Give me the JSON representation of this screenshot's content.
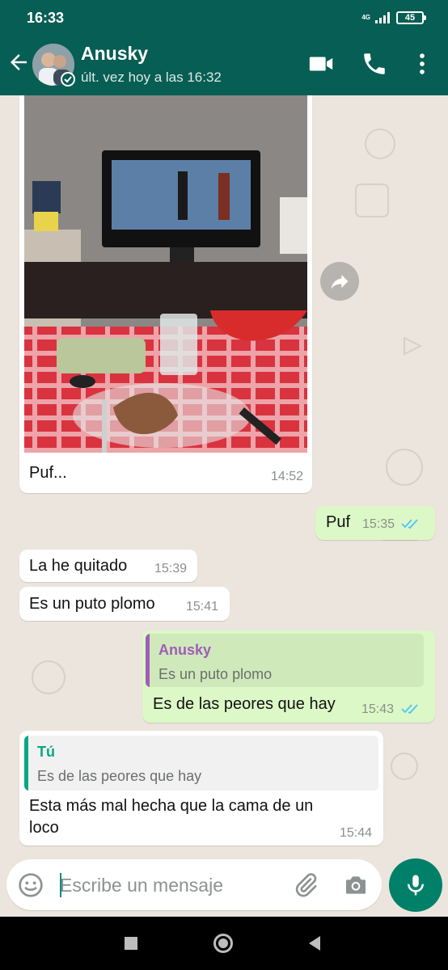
{
  "status_bar": {
    "time": "16:33",
    "network": "4G",
    "battery": "45"
  },
  "header": {
    "contact_name": "Anusky",
    "last_seen": "últ. vez hoy a las 16:32"
  },
  "messages": [
    {
      "id": "m1",
      "direction": "incoming",
      "type": "image",
      "caption": "Puf...",
      "time": "14:52"
    },
    {
      "id": "m2",
      "direction": "outgoing",
      "text": "Puf",
      "time": "15:35",
      "status": "read"
    },
    {
      "id": "m3",
      "direction": "incoming",
      "text": "La he quitado",
      "time": "15:39"
    },
    {
      "id": "m4",
      "direction": "incoming",
      "text": "Es un puto plomo",
      "time": "15:41"
    },
    {
      "id": "m5",
      "direction": "outgoing",
      "quote": {
        "author": "Anusky",
        "text": "Es un puto plomo"
      },
      "text": "Es de las peores que hay",
      "time": "15:43",
      "status": "read"
    },
    {
      "id": "m6",
      "direction": "incoming",
      "quote": {
        "author": "Tú",
        "text": "Es de las peores que hay"
      },
      "text_line1": "Esta más mal hecha que la cama de un",
      "text_line2": "loco",
      "time": "15:44"
    }
  ],
  "input": {
    "placeholder": "Escribe un mensaje"
  },
  "colors": {
    "header": "#075e54",
    "chat_bg": "#ece5dd",
    "outgoing_bubble": "#dcf8c6",
    "incoming_bubble": "#ffffff",
    "read_ticks": "#4fc3f7",
    "quote_purple": "#a05db8",
    "quote_green": "#06a884",
    "mic_button": "#008069"
  },
  "icons": [
    "back-arrow-icon",
    "video-call-icon",
    "phone-icon",
    "more-vert-icon",
    "forward-icon",
    "emoji-icon",
    "attach-icon",
    "camera-icon",
    "mic-icon",
    "nav-recents-icon",
    "nav-home-icon",
    "nav-back-icon"
  ]
}
